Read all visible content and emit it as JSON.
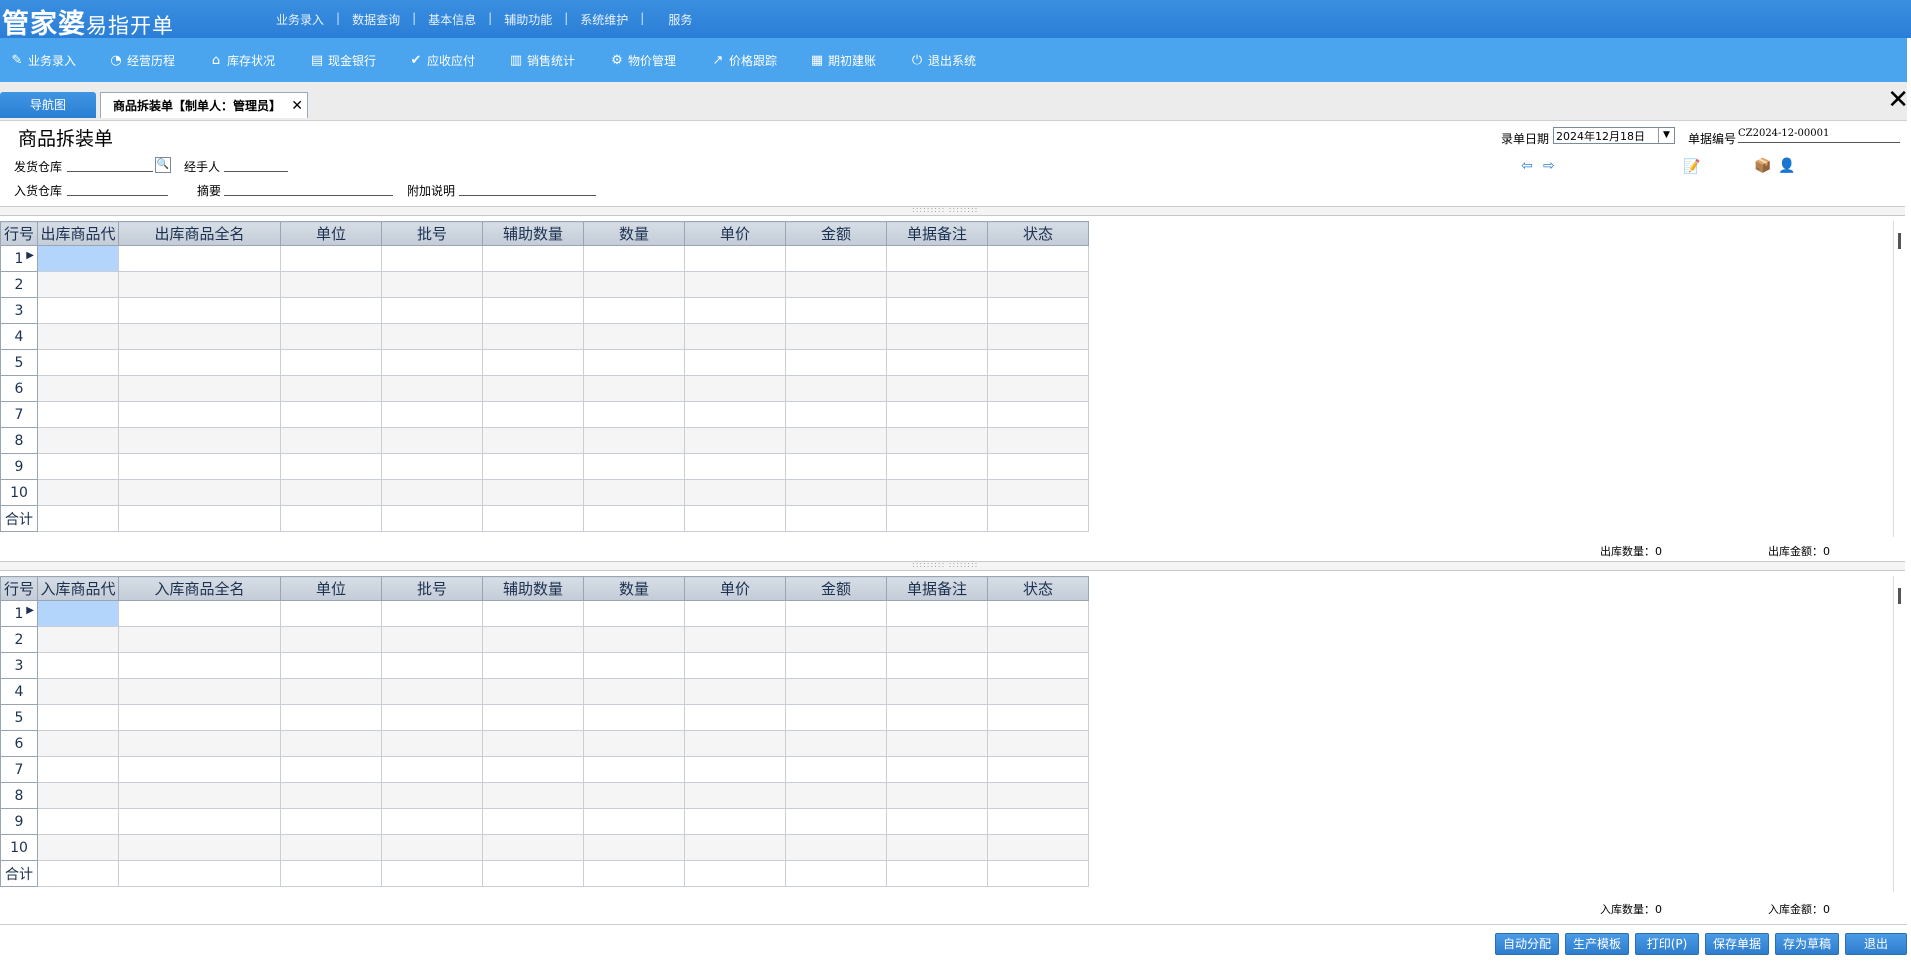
{
  "app": {
    "logo_main": "管家婆",
    "logo_sub": "易指开单"
  },
  "top_menu": [
    "业务录入",
    "数据查询",
    "基本信息",
    "辅助功能",
    "系统维护",
    "服务"
  ],
  "nav_items": [
    {
      "label": "业务录入",
      "icon": "pen-icon"
    },
    {
      "label": "经营历程",
      "icon": "pie-chart-icon"
    },
    {
      "label": "库存状况",
      "icon": "home-icon"
    },
    {
      "label": "现金银行",
      "icon": "document-icon"
    },
    {
      "label": "应收应付",
      "icon": "check-circle-icon"
    },
    {
      "label": "销售统计",
      "icon": "bar-chart-icon"
    },
    {
      "label": "物价管理",
      "icon": "gear-icon"
    },
    {
      "label": "价格跟踪",
      "icon": "arrow-icon"
    },
    {
      "label": "期初建账",
      "icon": "calendar-icon"
    },
    {
      "label": "退出系统",
      "icon": "power-icon"
    }
  ],
  "tabs": {
    "nav_tab": "导航图",
    "doc_tab": "商品拆装单【制单人：管理员】"
  },
  "form": {
    "title": "商品拆装单",
    "send_warehouse_label": "发货仓库",
    "handler_label": "经手人",
    "receive_warehouse_label": "入货仓库",
    "summary_label": "摘要",
    "extra_note_label": "附加说明",
    "date_label": "录单日期",
    "date_value": "2024年12月18日",
    "doc_no_label": "单据编号",
    "doc_no_value": "CZ2024-12-00001"
  },
  "out_table": {
    "columns": [
      "行号",
      "出库商品代",
      "出库商品全名",
      "单位",
      "批号",
      "辅助数量",
      "数量",
      "单价",
      "金额",
      "单据备注",
      "状态"
    ],
    "rows": [
      "1",
      "2",
      "3",
      "4",
      "5",
      "6",
      "7",
      "8",
      "9",
      "10"
    ],
    "sum_label": "合计",
    "qty_label": "出库数量：0",
    "amount_label": "出库金额：0"
  },
  "in_table": {
    "columns": [
      "行号",
      "入库商品代",
      "入库商品全名",
      "单位",
      "批号",
      "辅助数量",
      "数量",
      "单价",
      "金额",
      "单据备注",
      "状态"
    ],
    "rows": [
      "1",
      "2",
      "3",
      "4",
      "5",
      "6",
      "7",
      "8",
      "9",
      "10"
    ],
    "sum_label": "合计",
    "qty_label": "入库数量：0",
    "amount_label": "入库金额：0"
  },
  "buttons": {
    "auto_assign": "自动分配",
    "production_template": "生产模板",
    "print": "打印(P)",
    "save": "保存单据",
    "save_draft": "存为草稿",
    "exit": "退出"
  },
  "colors": {
    "topbar": "#2a7ed6",
    "navbar": "#4aa4ee",
    "selected_cell": "#b3d4fb",
    "button": "#2e7dcd"
  }
}
